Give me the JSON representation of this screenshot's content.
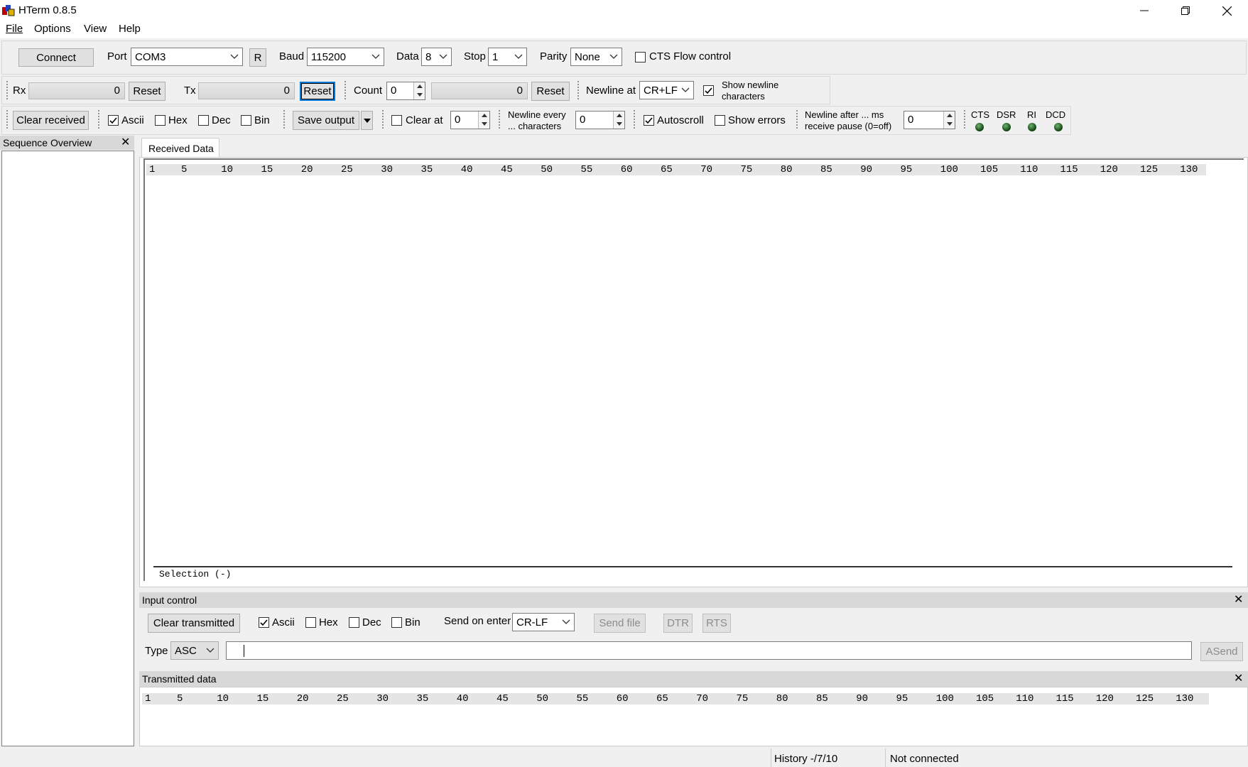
{
  "window": {
    "title": "HTerm 0.8.5",
    "minimize": "—",
    "restore": "❐",
    "close": "✕"
  },
  "menu": {
    "file": "File",
    "options": "Options",
    "view": "View",
    "help": "Help"
  },
  "connection": {
    "connect_label": "Connect",
    "port_label": "Port",
    "port_value": "COM3",
    "r_label": "R",
    "baud_label": "Baud",
    "baud_value": "115200",
    "data_label": "Data",
    "data_value": "8",
    "stop_label": "Stop",
    "stop_value": "1",
    "parity_label": "Parity",
    "parity_value": "None",
    "cts_flow_label": "CTS Flow control",
    "cts_flow_checked": false
  },
  "counters": {
    "rx_label": "Rx",
    "rx_value": "0",
    "rx_reset": "Reset",
    "tx_label": "Tx",
    "tx_value": "0",
    "tx_reset": "Reset",
    "count_label": "Count",
    "count_value": "0",
    "count_display": "0",
    "count_reset": "Reset",
    "newline_at_label": "Newline at",
    "newline_at_value": "CR+LF",
    "show_newline_line1": "Show newline",
    "show_newline_line2": "characters",
    "show_newline_checked": true
  },
  "receive_options": {
    "clear_received": "Clear received",
    "ascii": "Ascii",
    "ascii_checked": true,
    "hex": "Hex",
    "dec": "Dec",
    "bin": "Bin",
    "save_output": "Save output",
    "clear_at": "Clear at",
    "clear_at_value": "0",
    "newline_every_1": "Newline every",
    "newline_every_2": "... characters",
    "newline_every_value": "0",
    "autoscroll": "Autoscroll",
    "autoscroll_checked": true,
    "show_errors": "Show errors",
    "newline_after_1": "Newline after ... ms",
    "newline_after_2": "receive pause (0=off)",
    "newline_after_value": "0",
    "cts": "CTS",
    "dsr": "DSR",
    "ri": "RI",
    "dcd": "DCD"
  },
  "sequence_overview": {
    "title": "Sequence Overview"
  },
  "received": {
    "tab": "Received Data",
    "ruler": [
      "1",
      "5",
      "10",
      "15",
      "20",
      "25",
      "30",
      "35",
      "40",
      "45",
      "50",
      "55",
      "60",
      "65",
      "70",
      "75",
      "80",
      "85",
      "90",
      "95",
      "100",
      "105",
      "110",
      "115",
      "120",
      "125",
      "130"
    ],
    "selection": "Selection (-)"
  },
  "input_control": {
    "title": "Input control",
    "clear_transmitted": "Clear transmitted",
    "ascii": "Ascii",
    "ascii_checked": true,
    "hex": "Hex",
    "dec": "Dec",
    "bin": "Bin",
    "send_on_enter_label": "Send on enter",
    "send_on_enter_value": "CR-LF",
    "send_file": "Send file",
    "dtr": "DTR",
    "rts": "RTS",
    "type_label": "Type",
    "type_value": "ASC",
    "input_value": "",
    "asend": "ASend"
  },
  "transmitted": {
    "title": "Transmitted data",
    "ruler": [
      "1",
      "5",
      "10",
      "15",
      "20",
      "25",
      "30",
      "35",
      "40",
      "45",
      "50",
      "55",
      "60",
      "65",
      "70",
      "75",
      "80",
      "85",
      "90",
      "95",
      "100",
      "105",
      "110",
      "115",
      "120",
      "125",
      "130"
    ]
  },
  "status": {
    "history": "History -/7/10",
    "connection": "Not connected"
  }
}
